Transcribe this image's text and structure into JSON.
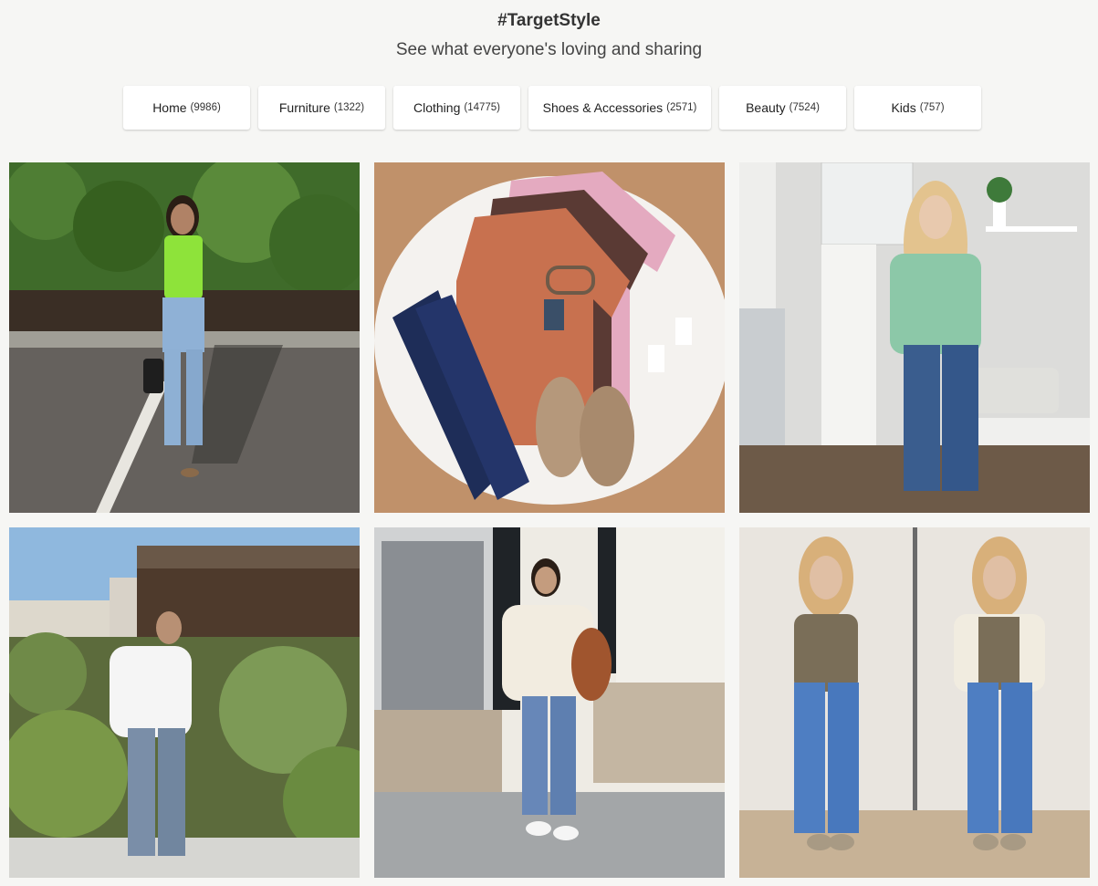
{
  "header": {
    "title": "#TargetStyle",
    "subtitle": "See what everyone's loving and sharing"
  },
  "categories": [
    {
      "label": "Home",
      "count": "(9986)"
    },
    {
      "label": "Furniture",
      "count": "(1322)"
    },
    {
      "label": "Clothing",
      "count": "(14775)"
    },
    {
      "label": "Shoes & Accessories",
      "count": "(2571)"
    },
    {
      "label": "Beauty",
      "count": "(7524)"
    },
    {
      "label": "Kids",
      "count": "(757)"
    }
  ],
  "photos": [
    {
      "icon": "photo-woman-green-top-parking-lot"
    },
    {
      "icon": "photo-flatlay-mock-neck-tees-jeans-booties"
    },
    {
      "icon": "photo-woman-mint-blouse-kitchen"
    },
    {
      "icon": "photo-woman-white-shirt-garden"
    },
    {
      "icon": "photo-woman-cable-sweater-porch"
    },
    {
      "icon": "photo-woman-olive-tee-mirror-selfie"
    }
  ]
}
